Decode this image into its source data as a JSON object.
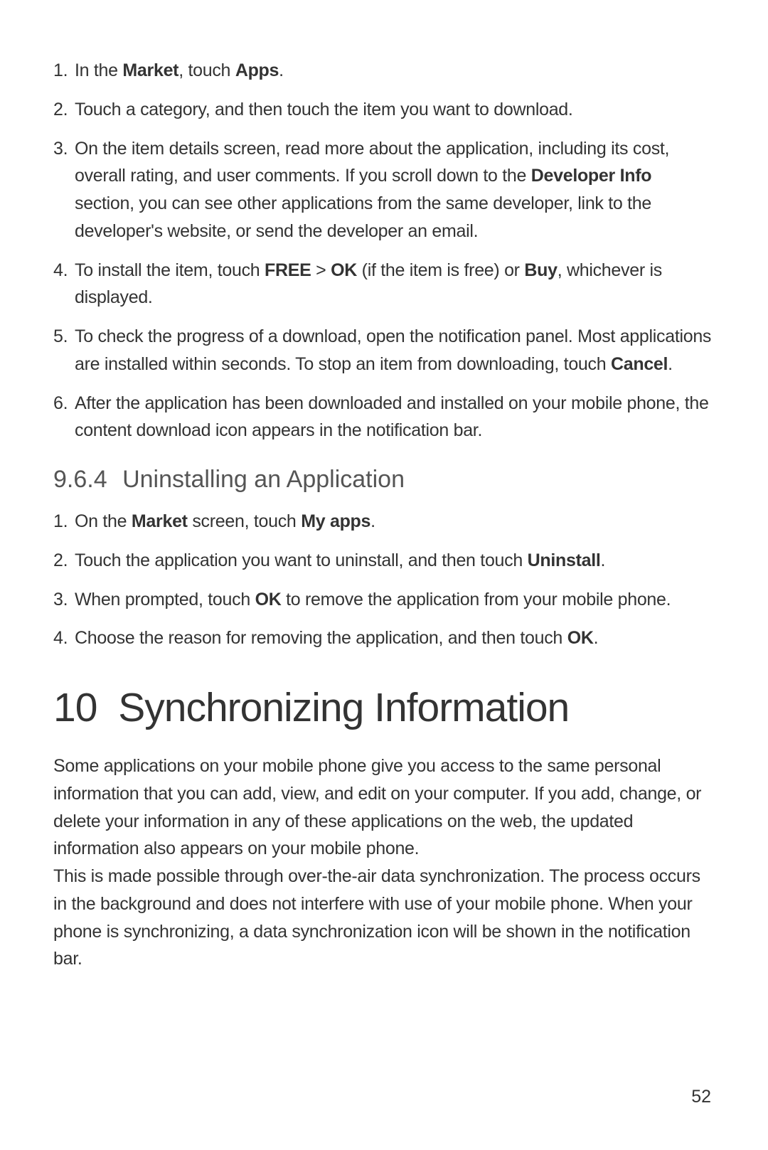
{
  "install_steps": [
    {
      "num": "1.",
      "segments": [
        {
          "t": "In the ",
          "b": false
        },
        {
          "t": "Market",
          "b": true
        },
        {
          "t": ", touch ",
          "b": false
        },
        {
          "t": "Apps",
          "b": true
        },
        {
          "t": ".",
          "b": false
        }
      ]
    },
    {
      "num": "2.",
      "segments": [
        {
          "t": "Touch a category, and then touch the item you want to download.",
          "b": false
        }
      ]
    },
    {
      "num": "3.",
      "segments": [
        {
          "t": "On the item details screen, read more about the application, including its cost, overall rating, and user comments. If you scroll down to the ",
          "b": false
        },
        {
          "t": "Developer Info",
          "b": true
        },
        {
          "t": " section, you can see other applications from the same developer, link to the developer's website, or send the developer an email.",
          "b": false
        }
      ]
    },
    {
      "num": "4.",
      "segments": [
        {
          "t": "To install the item, touch ",
          "b": false
        },
        {
          "t": "FREE",
          "b": true
        },
        {
          "t": " > ",
          "b": false
        },
        {
          "t": "OK",
          "b": true
        },
        {
          "t": " (if the item is free) or ",
          "b": false
        },
        {
          "t": "Buy",
          "b": true
        },
        {
          "t": ", whichever is displayed.",
          "b": false
        }
      ]
    },
    {
      "num": "5.",
      "segments": [
        {
          "t": "To check the progress of a download, open the notification panel. Most applications are installed within seconds. To stop an item from downloading, touch ",
          "b": false
        },
        {
          "t": "Cancel",
          "b": true
        },
        {
          "t": ".",
          "b": false
        }
      ]
    },
    {
      "num": "6.",
      "segments": [
        {
          "t": "After the application has been downloaded and installed on your mobile phone, the content download icon appears in the notification bar.",
          "b": false
        }
      ]
    }
  ],
  "subsection": {
    "num": "9.6.4",
    "title": "Uninstalling an Application"
  },
  "uninstall_steps": [
    {
      "num": "1.",
      "segments": [
        {
          "t": "On the ",
          "b": false
        },
        {
          "t": "Market",
          "b": true
        },
        {
          "t": " screen, touch ",
          "b": false
        },
        {
          "t": "My apps",
          "b": true
        },
        {
          "t": ".",
          "b": false
        }
      ]
    },
    {
      "num": "2.",
      "segments": [
        {
          "t": "Touch the application you want to uninstall, and then touch ",
          "b": false
        },
        {
          "t": "Uninstall",
          "b": true
        },
        {
          "t": ".",
          "b": false
        }
      ]
    },
    {
      "num": "3.",
      "segments": [
        {
          "t": "When prompted, touch ",
          "b": false
        },
        {
          "t": "OK",
          "b": true
        },
        {
          "t": " to remove the application from your mobile phone.",
          "b": false
        }
      ]
    },
    {
      "num": "4.",
      "segments": [
        {
          "t": "Choose the reason for removing the application, and then touch ",
          "b": false
        },
        {
          "t": "OK",
          "b": true
        },
        {
          "t": ".",
          "b": false
        }
      ]
    }
  ],
  "chapter": {
    "num": "10",
    "title": "Synchronizing Information"
  },
  "chapter_body": {
    "para1": "Some applications on your mobile phone give you access to the same personal information that you can add, view, and edit on your computer. If you add, change, or delete your information in any of these applications on the web, the updated information also appears on your mobile phone.",
    "para2": "This is made possible through over-the-air data synchronization. The process occurs in the background and does not interfere with use of your mobile phone. When your phone is synchronizing, a data synchronization icon will be shown in the notification bar."
  },
  "page_number": "52"
}
